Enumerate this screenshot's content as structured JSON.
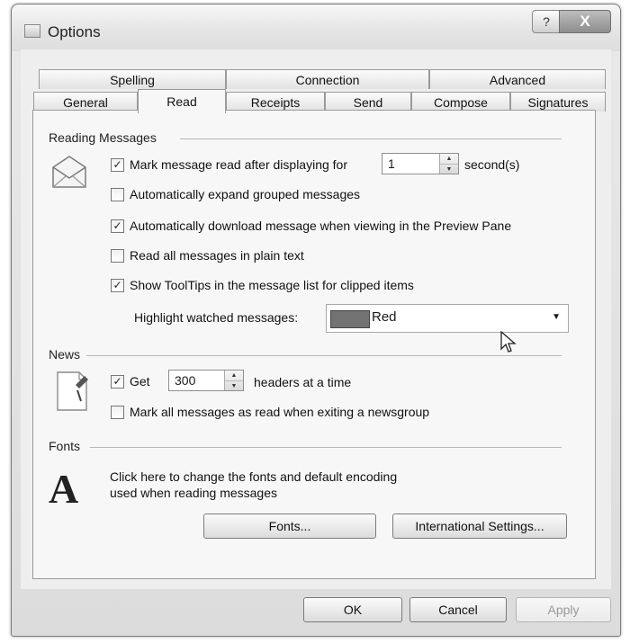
{
  "window": {
    "title": "Options"
  },
  "titlebar": {
    "help_glyph": "?",
    "close_glyph": "X"
  },
  "tabs": {
    "row1": [
      "Spelling",
      "Connection",
      "Advanced"
    ],
    "row2": [
      "General",
      "Read",
      "Receipts",
      "Send",
      "Compose",
      "Signatures"
    ],
    "active": "Read"
  },
  "reading": {
    "title": "Reading Messages",
    "mark_read_label": "Mark message read after displaying for",
    "mark_read_checked": true,
    "seconds_value": "1",
    "seconds_label": "second(s)",
    "auto_expand_label": "Automatically expand grouped messages",
    "auto_expand_checked": false,
    "auto_download_label": "Automatically download message when viewing in the Preview Pane",
    "auto_download_checked": true,
    "plain_text_label": "Read all messages in plain text",
    "plain_text_checked": false,
    "tooltips_label": "Show ToolTips in the message list for clipped items",
    "tooltips_checked": true,
    "highlight_label": "Highlight watched messages:",
    "highlight_value": "Red",
    "highlight_swatch_color": "#727272"
  },
  "news": {
    "title": "News",
    "get_label": "Get",
    "get_checked": true,
    "headers_value": "300",
    "headers_label": "headers at a time",
    "mark_all_label": "Mark all messages as read when exiting a newsgroup",
    "mark_all_checked": false
  },
  "fonts": {
    "title": "Fonts",
    "description_line1": "Click here to change the fonts and default encoding",
    "description_line2": "used when reading messages",
    "icon_glyph": "A",
    "fonts_button": "Fonts...",
    "intl_button": "International Settings..."
  },
  "footer": {
    "ok": "OK",
    "cancel": "Cancel",
    "apply": "Apply"
  },
  "icons": {
    "window": "window-icon",
    "reading": "envelope-icon",
    "news": "news-document-icon",
    "fonts": "font-letter-icon"
  }
}
